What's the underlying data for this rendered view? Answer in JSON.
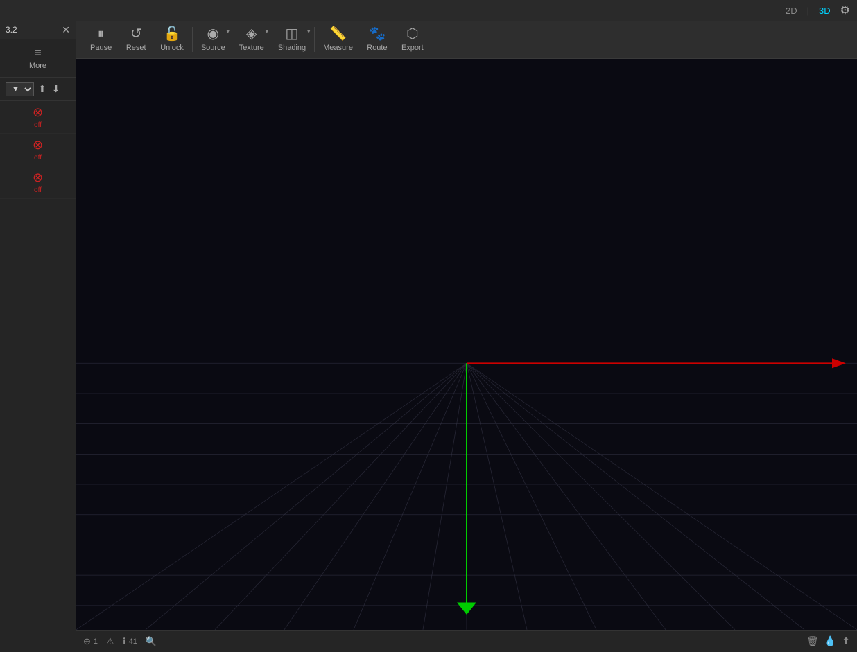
{
  "topbar": {
    "btn_2d": "2D",
    "btn_3d": "3D",
    "settings_label": "⚙"
  },
  "sidebar": {
    "title": "3.2",
    "close_label": "✕",
    "more_icon": "≡",
    "more_label": "More",
    "layers": [
      {
        "icon": "⊗",
        "label": "off"
      },
      {
        "icon": "⊗",
        "label": "off"
      },
      {
        "icon": "⊗",
        "label": "off"
      }
    ]
  },
  "toolbar": {
    "items": [
      {
        "id": "pause",
        "icon": "⏸",
        "label": "Pause"
      },
      {
        "id": "reset",
        "icon": "↺",
        "label": "Reset"
      },
      {
        "id": "unlock",
        "icon": "🔓",
        "label": "Unlock"
      },
      {
        "id": "source",
        "icon": "◉",
        "label": "Source",
        "has_arrow": true
      },
      {
        "id": "texture",
        "icon": "◈",
        "label": "Texture",
        "has_arrow": true
      },
      {
        "id": "shading",
        "icon": "◫",
        "label": "Shading",
        "has_arrow": true
      },
      {
        "id": "measure",
        "icon": "📏",
        "label": "Measure"
      },
      {
        "id": "route",
        "icon": "🐾",
        "label": "Route"
      },
      {
        "id": "export",
        "icon": "⬡",
        "label": "Export"
      }
    ]
  },
  "statusbar": {
    "items": [
      {
        "icon": "⊕",
        "value": "1"
      },
      {
        "icon": "⚠",
        "value": ""
      },
      {
        "icon": "ℹ",
        "value": "41"
      },
      {
        "icon": "🔍",
        "value": ""
      }
    ],
    "right_icons": [
      "🗑",
      "💧",
      "⬆"
    ]
  },
  "viewport": {
    "bg_color": "#080812"
  }
}
